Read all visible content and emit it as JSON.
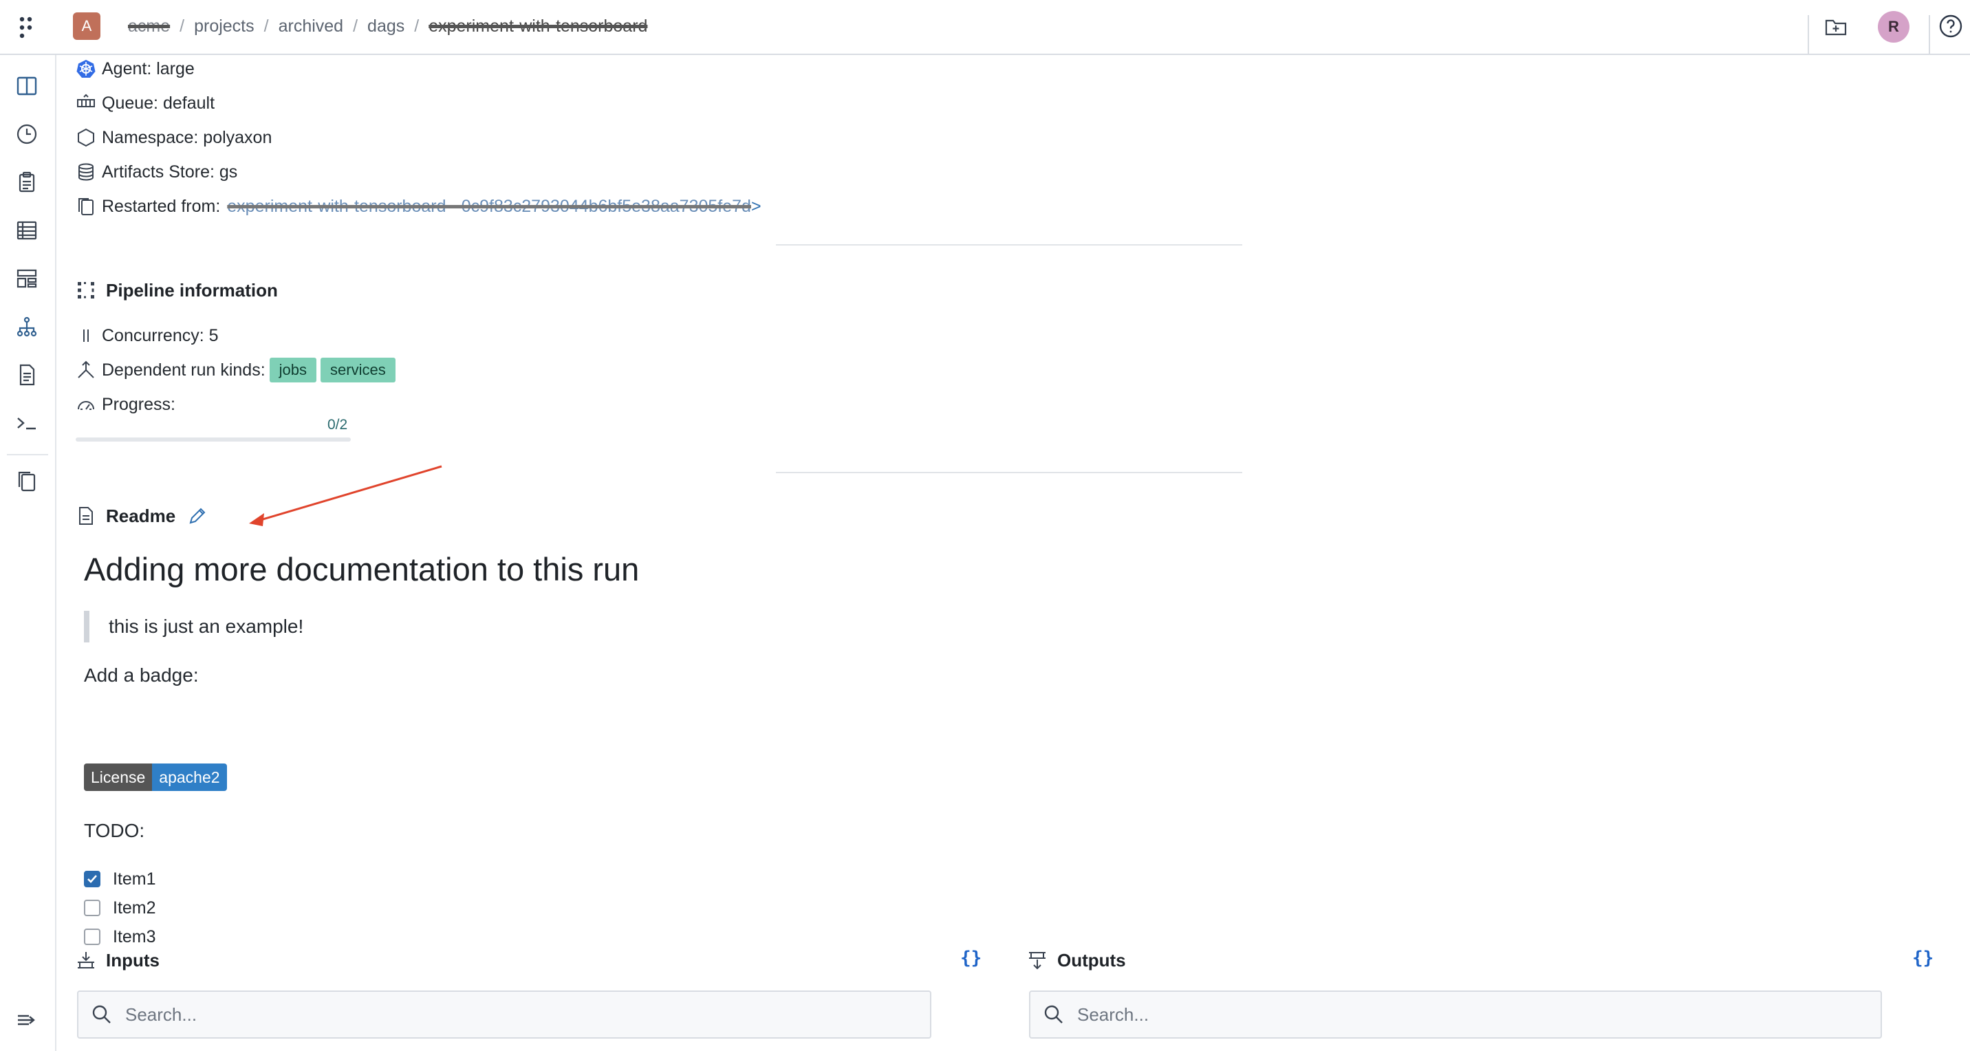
{
  "topbar": {
    "org_avatar": "A",
    "breadcrumb": [
      {
        "label": "acme",
        "redacted": true
      },
      {
        "label": "projects"
      },
      {
        "label": "archived"
      },
      {
        "label": "dags"
      },
      {
        "label": "experiment-with-tensorboard",
        "redacted": true
      }
    ],
    "separator": "/",
    "user_avatar": "R"
  },
  "run_info": {
    "agent": "Agent: large",
    "queue": "Queue: default",
    "namespace": "Namespace: polyaxon",
    "artifacts_store": "Artifacts Store: gs",
    "restarted_from_label": "Restarted from:",
    "restarted_from_value": "experiment-with-tensorboard - 0c9f83c2793044b6bf5e38aa7305fe7d"
  },
  "pipeline": {
    "title": "Pipeline information",
    "concurrency": "Concurrency: 5",
    "dependent_kinds_label": "Dependent run kinds:",
    "dependent_kinds": [
      "jobs",
      "services"
    ],
    "progress_label": "Progress:",
    "progress_text": "0/2",
    "progress_fraction": 0.0
  },
  "readme": {
    "title": "Readme",
    "heading": "Adding more documentation to this run",
    "quote": "this is just an example!",
    "badge_intro": "Add a badge:",
    "badge_left": "License",
    "badge_right": "apache2",
    "todo_title": "TODO:",
    "todos": [
      {
        "label": "Item1",
        "checked": true
      },
      {
        "label": "Item2",
        "checked": false
      },
      {
        "label": "Item3",
        "checked": false
      }
    ]
  },
  "inputs": {
    "title": "Inputs",
    "search_placeholder": "Search...",
    "json_label": "{}"
  },
  "outputs": {
    "title": "Outputs",
    "search_placeholder": "Search...",
    "json_label": "{}"
  },
  "colors": {
    "accent": "#2b6cb0",
    "tag": "#7fd0b6",
    "progress": "#2d9e7f",
    "annotation_arrow": "#e0442c"
  }
}
